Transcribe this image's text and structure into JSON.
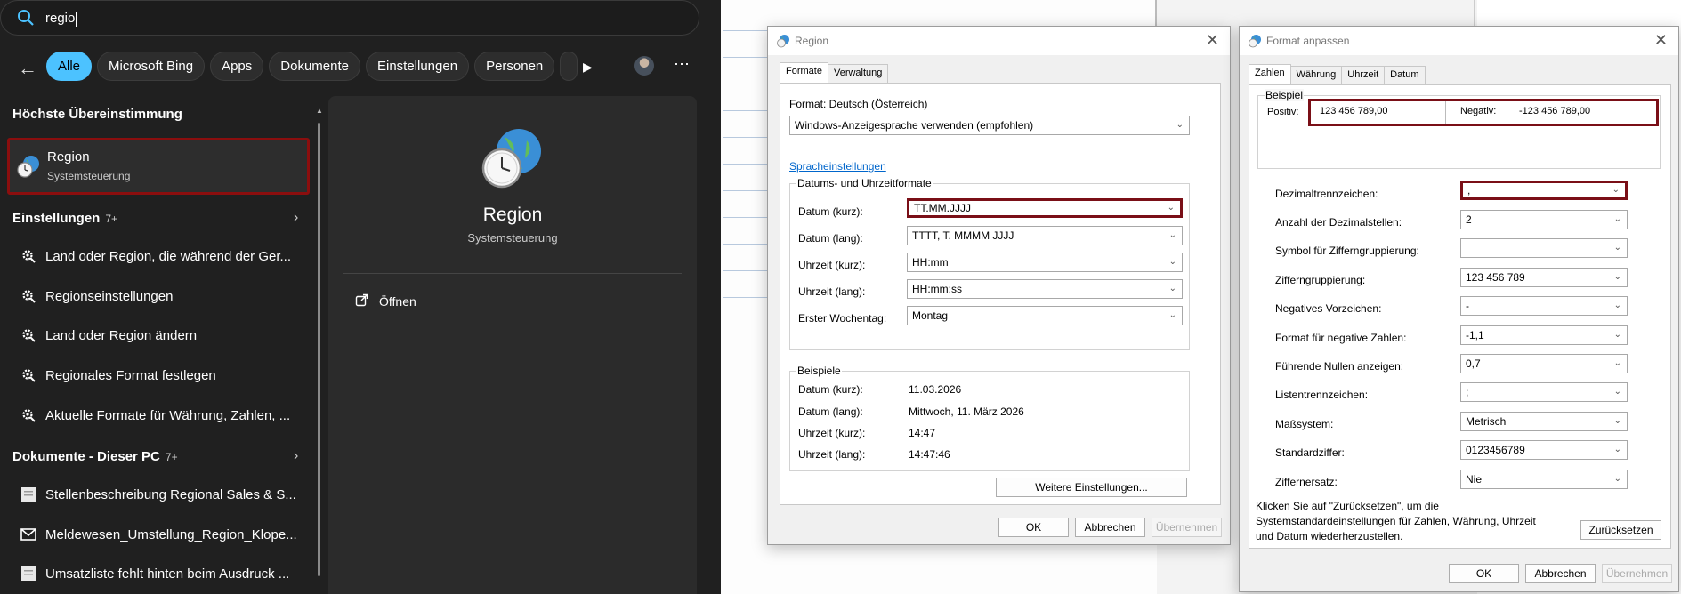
{
  "search": {
    "query": "regio",
    "filters": [
      "Alle",
      "Microsoft Bing",
      "Apps",
      "Dokumente",
      "Einstellungen",
      "Personen"
    ],
    "best_match_header": "Höchste Übereinstimmung",
    "best_match": {
      "title": "Region",
      "subtitle": "Systemsteuerung"
    },
    "settings_header": "Einstellungen",
    "settings_count": "7+",
    "settings_items": [
      "Land oder Region, die während der Ger...",
      "Regionseinstellungen",
      "Land oder Region ändern",
      "Regionales Format festlegen",
      "Aktuelle Formate für Währung, Zahlen, ..."
    ],
    "docs_header": "Dokumente - Dieser PC",
    "docs_count": "7+",
    "doc_items": [
      "Stellenbeschreibung Regional Sales & S...",
      "Meldewesen_Umstellung_Region_Klope...",
      "Umsatzliste fehlt hinten beim Ausdruck ..."
    ],
    "preview": {
      "title": "Region",
      "subtitle": "Systemsteuerung",
      "action": "Öffnen"
    }
  },
  "region_dialog": {
    "title": "Region",
    "tabs": [
      "Formate",
      "Verwaltung"
    ],
    "format_label": "Format: Deutsch (Österreich)",
    "format_value": "Windows-Anzeigesprache verwenden (empfohlen)",
    "language_link": "Spracheinstellungen",
    "datetime_group": "Datums- und Uhrzeitformate",
    "fields": [
      {
        "label": "Datum (kurz):",
        "value": "TT.MM.JJJJ"
      },
      {
        "label": "Datum (lang):",
        "value": "TTTT, T. MMMM JJJJ"
      },
      {
        "label": "Uhrzeit (kurz):",
        "value": "HH:mm"
      },
      {
        "label": "Uhrzeit (lang):",
        "value": "HH:mm:ss"
      },
      {
        "label": "Erster Wochentag:",
        "value": "Montag"
      }
    ],
    "examples_group": "Beispiele",
    "examples": [
      {
        "label": "Datum (kurz):",
        "value": "11.03.2026"
      },
      {
        "label": "Datum (lang):",
        "value": "Mittwoch, 11. März 2026"
      },
      {
        "label": "Uhrzeit (kurz):",
        "value": "14:47"
      },
      {
        "label": "Uhrzeit (lang):",
        "value": "14:47:46"
      }
    ],
    "more_button": "Weitere Einstellungen...",
    "ok": "OK",
    "cancel": "Abbrechen",
    "apply": "Übernehmen"
  },
  "format_dialog": {
    "title": "Format anpassen",
    "tabs": [
      "Zahlen",
      "Währung",
      "Uhrzeit",
      "Datum"
    ],
    "example_group": "Beispiel",
    "positive_label": "Positiv:",
    "positive_value": "123 456 789,00",
    "negative_label": "Negativ:",
    "negative_value": "-123 456 789,00",
    "fields": [
      {
        "label": "Dezimaltrennzeichen:",
        "value": ","
      },
      {
        "label": "Anzahl der Dezimalstellen:",
        "value": "2"
      },
      {
        "label": "Symbol für Zifferngruppierung:",
        "value": ""
      },
      {
        "label": "Zifferngruppierung:",
        "value": "123 456 789"
      },
      {
        "label": "Negatives Vorzeichen:",
        "value": "-"
      },
      {
        "label": "Format für negative Zahlen:",
        "value": "-1,1"
      },
      {
        "label": "Führende Nullen anzeigen:",
        "value": "0,7"
      },
      {
        "label": "Listentrennzeichen:",
        "value": ";"
      },
      {
        "label": "Maßsystem:",
        "value": "Metrisch"
      },
      {
        "label": "Standardziffer:",
        "value": "0123456789"
      },
      {
        "label": "Ziffernersatz:",
        "value": "Nie"
      }
    ],
    "reset_text_1": "Klicken Sie auf \"Zurücksetzen\", um die",
    "reset_text_2": "Systemstandardeinstellungen für Zahlen, Währung, Uhrzeit",
    "reset_text_3": "und Datum wiederherzustellen.",
    "reset_button": "Zurücksetzen",
    "ok": "OK",
    "cancel": "Abbrechen",
    "apply": "Übernehmen"
  },
  "colors": {
    "accent": "#4cc2ff",
    "highlight": "#7a0f17",
    "dark_bg": "#202020"
  }
}
